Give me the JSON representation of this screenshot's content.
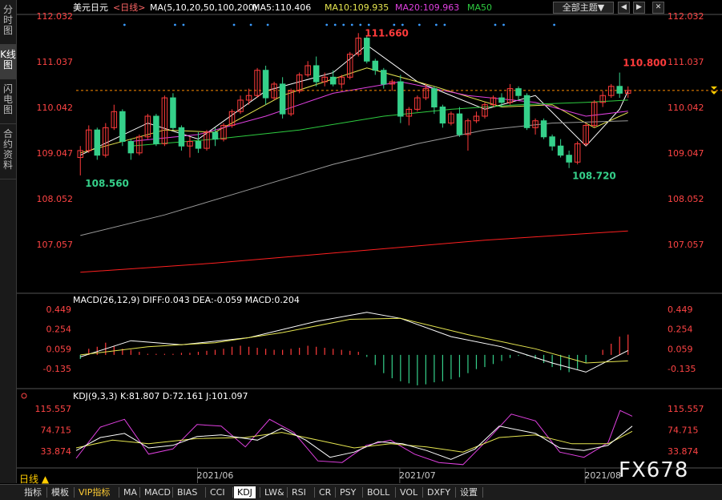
{
  "sidebar": [
    "分时图",
    "K线图",
    "闪电图",
    "合约资料"
  ],
  "header": {
    "symbol": "美元日元",
    "period_tag": "<日线>",
    "ma_label": "MA(5,10,20,50,100,200)",
    "ma5": "MA5:110.406",
    "ma10": "MA10:109.935",
    "ma20": "MA20:109.963",
    "ma50": "MA50",
    "theme_button": "全部主题▼"
  },
  "colors": {
    "up": "#ff3b3b",
    "down": "#35d08a",
    "ma5": "#ffffff",
    "ma10": "#e6e650",
    "ma20": "#e040e0",
    "ma50": "#2ecc40",
    "ma100": "#9a9a9a",
    "ma200": "#ff2020",
    "axis_text": "#ff4444",
    "price_line": "#ff8c00"
  },
  "chart_data": [
    {
      "type": "candlestick",
      "title": "美元日元 <日线>",
      "y_ticks": [
        112.032,
        111.037,
        110.042,
        109.047,
        108.052,
        107.057
      ],
      "ylim": [
        106.3,
        112.3
      ],
      "x_ticks": [
        "2021/06",
        "2021/07",
        "2021/08"
      ],
      "annotations": [
        "108.560",
        "111.660",
        "110.800",
        "108.720"
      ],
      "current_price": 110.41,
      "note": "candle OHLC not printed; candles below are an approximate price path",
      "candles": [
        [
          108.95,
          109.2,
          108.56,
          109.1
        ],
        [
          109.1,
          109.65,
          109.05,
          109.55
        ],
        [
          109.55,
          109.6,
          108.9,
          109.0
        ],
        [
          109.0,
          109.7,
          108.95,
          109.6
        ],
        [
          109.6,
          110.1,
          109.55,
          109.95
        ],
        [
          109.95,
          110.0,
          109.2,
          109.3
        ],
        [
          109.3,
          109.35,
          108.9,
          109.05
        ],
        [
          109.05,
          109.45,
          109.0,
          109.4
        ],
        [
          109.4,
          109.9,
          109.35,
          109.85
        ],
        [
          109.85,
          109.9,
          109.2,
          109.25
        ],
        [
          109.25,
          110.3,
          109.2,
          110.25
        ],
        [
          110.25,
          110.35,
          109.55,
          109.6
        ],
        [
          109.6,
          109.65,
          109.1,
          109.2
        ],
        [
          109.2,
          109.4,
          108.95,
          109.3
        ],
        [
          109.3,
          109.5,
          109.05,
          109.15
        ],
        [
          109.15,
          109.55,
          109.1,
          109.5
        ],
        [
          109.5,
          109.6,
          109.2,
          109.35
        ],
        [
          109.35,
          109.7,
          109.3,
          109.65
        ],
        [
          109.65,
          110.0,
          109.6,
          109.95
        ],
        [
          109.95,
          110.3,
          109.9,
          110.2
        ],
        [
          110.2,
          110.45,
          110.1,
          110.3
        ],
        [
          110.3,
          110.9,
          110.25,
          110.85
        ],
        [
          110.85,
          110.95,
          110.1,
          110.25
        ],
        [
          110.25,
          110.6,
          110.2,
          110.55
        ],
        [
          110.55,
          110.7,
          109.8,
          109.9
        ],
        [
          109.9,
          110.45,
          109.85,
          110.4
        ],
        [
          110.4,
          110.8,
          110.35,
          110.75
        ],
        [
          110.75,
          111.05,
          110.7,
          110.95
        ],
        [
          110.95,
          111.15,
          110.5,
          110.6
        ],
        [
          110.6,
          110.8,
          110.5,
          110.7
        ],
        [
          110.7,
          110.85,
          110.5,
          110.55
        ],
        [
          110.55,
          110.75,
          110.45,
          110.7
        ],
        [
          110.7,
          111.25,
          110.65,
          111.2
        ],
        [
          111.2,
          111.66,
          111.15,
          111.55
        ],
        [
          111.55,
          111.6,
          111.0,
          111.05
        ],
        [
          111.05,
          111.1,
          110.75,
          110.85
        ],
        [
          110.85,
          110.9,
          110.45,
          110.55
        ],
        [
          110.55,
          110.65,
          110.4,
          110.6
        ],
        [
          110.6,
          110.75,
          109.7,
          109.85
        ],
        [
          109.85,
          110.05,
          109.65,
          110.0
        ],
        [
          110.0,
          110.3,
          109.95,
          110.25
        ],
        [
          110.25,
          110.55,
          110.2,
          110.45
        ],
        [
          110.45,
          110.5,
          109.9,
          110.05
        ],
        [
          110.05,
          110.1,
          109.6,
          109.7
        ],
        [
          109.7,
          109.95,
          109.65,
          109.9
        ],
        [
          109.9,
          110.05,
          109.4,
          109.45
        ],
        [
          109.45,
          109.8,
          109.1,
          109.75
        ],
        [
          109.75,
          109.95,
          109.7,
          109.85
        ],
        [
          109.85,
          110.15,
          109.8,
          110.1
        ],
        [
          110.1,
          110.3,
          110.05,
          110.25
        ],
        [
          110.25,
          110.35,
          110.05,
          110.15
        ],
        [
          110.15,
          110.55,
          110.1,
          110.45
        ],
        [
          110.45,
          110.5,
          110.2,
          110.3
        ],
        [
          110.3,
          110.35,
          109.55,
          109.6
        ],
        [
          109.6,
          109.8,
          109.45,
          109.75
        ],
        [
          109.75,
          109.8,
          109.35,
          109.4
        ],
        [
          109.4,
          109.45,
          109.1,
          109.2
        ],
        [
          109.2,
          109.35,
          108.95,
          109.0
        ],
        [
          109.0,
          109.1,
          108.72,
          108.85
        ],
        [
          108.85,
          109.3,
          108.8,
          109.25
        ],
        [
          109.25,
          109.7,
          109.2,
          109.65
        ],
        [
          109.65,
          110.2,
          109.6,
          110.15
        ],
        [
          110.15,
          110.4,
          110.05,
          110.3
        ],
        [
          110.3,
          110.55,
          110.25,
          110.5
        ],
        [
          110.5,
          110.8,
          110.25,
          110.35
        ],
        [
          110.35,
          110.5,
          110.25,
          110.41
        ]
      ],
      "ma_lines": {
        "ma5": [
          [
            0,
            109.0
          ],
          [
            8,
            109.7
          ],
          [
            14,
            109.35
          ],
          [
            22,
            110.4
          ],
          [
            30,
            110.8
          ],
          [
            34,
            111.4
          ],
          [
            40,
            110.6
          ],
          [
            48,
            110.0
          ],
          [
            54,
            110.3
          ],
          [
            60,
            109.2
          ],
          [
            64,
            110.0
          ],
          [
            65,
            110.4
          ]
        ],
        "ma10": [
          [
            0,
            109.05
          ],
          [
            10,
            109.55
          ],
          [
            16,
            109.5
          ],
          [
            24,
            110.3
          ],
          [
            34,
            110.9
          ],
          [
            42,
            110.5
          ],
          [
            50,
            110.05
          ],
          [
            56,
            110.1
          ],
          [
            61,
            109.6
          ],
          [
            65,
            109.93
          ]
        ],
        "ma20": [
          [
            6,
            109.3
          ],
          [
            14,
            109.45
          ],
          [
            22,
            109.85
          ],
          [
            30,
            110.35
          ],
          [
            38,
            110.6
          ],
          [
            46,
            110.3
          ],
          [
            54,
            110.15
          ],
          [
            60,
            109.85
          ],
          [
            65,
            109.96
          ]
        ],
        "ma50": [
          [
            6,
            109.2
          ],
          [
            16,
            109.35
          ],
          [
            26,
            109.55
          ],
          [
            36,
            109.85
          ],
          [
            44,
            110.0
          ],
          [
            52,
            110.1
          ],
          [
            60,
            110.15
          ],
          [
            65,
            110.2
          ]
        ],
        "ma100": [
          [
            0,
            107.25
          ],
          [
            10,
            107.7
          ],
          [
            20,
            108.25
          ],
          [
            30,
            108.8
          ],
          [
            40,
            109.25
          ],
          [
            48,
            109.55
          ],
          [
            56,
            109.7
          ],
          [
            65,
            109.75
          ]
        ],
        "ma200": [
          [
            0,
            106.45
          ],
          [
            16,
            106.65
          ],
          [
            32,
            106.9
          ],
          [
            48,
            107.15
          ],
          [
            65,
            107.35
          ]
        ]
      }
    },
    {
      "type": "line",
      "title": "MACD(26,12,9) DIFF:0.043 DEA:-0.059 MACD:0.204",
      "y_ticks": [
        0.449,
        0.254,
        0.059,
        -0.135
      ],
      "ylim": [
        -0.34,
        0.52
      ],
      "diff": [
        [
          0,
          -0.02
        ],
        [
          6,
          0.14
        ],
        [
          12,
          0.1
        ],
        [
          20,
          0.17
        ],
        [
          28,
          0.33
        ],
        [
          34,
          0.42
        ],
        [
          38,
          0.36
        ],
        [
          44,
          0.18
        ],
        [
          50,
          0.08
        ],
        [
          56,
          -0.08
        ],
        [
          60,
          -0.17
        ],
        [
          65,
          0.043
        ]
      ],
      "dea": [
        [
          0,
          0.0
        ],
        [
          8,
          0.08
        ],
        [
          16,
          0.12
        ],
        [
          24,
          0.22
        ],
        [
          32,
          0.35
        ],
        [
          38,
          0.36
        ],
        [
          46,
          0.2
        ],
        [
          54,
          0.06
        ],
        [
          60,
          -0.08
        ],
        [
          65,
          -0.059
        ]
      ],
      "histogram": [
        -0.04,
        0.06,
        0.08,
        0.12,
        0.09,
        0.06,
        0.05,
        0.03,
        0.01,
        0.01,
        0.01,
        0.01,
        0.02,
        0.02,
        0.03,
        0.04,
        0.05,
        0.06,
        0.08,
        0.09,
        0.08,
        0.07,
        0.06,
        0.05,
        0.05,
        0.06,
        0.07,
        0.09,
        0.08,
        0.07,
        0.06,
        0.05,
        0.04,
        0.03,
        -0.02,
        -0.1,
        -0.18,
        -0.23,
        -0.26,
        -0.28,
        -0.3,
        -0.29,
        -0.27,
        -0.26,
        -0.24,
        -0.22,
        -0.18,
        -0.14,
        -0.12,
        -0.09,
        -0.06,
        -0.03,
        -0.01,
        -0.01,
        -0.04,
        -0.08,
        -0.12,
        -0.15,
        -0.17,
        -0.14,
        -0.08,
        0.0,
        0.05,
        0.11,
        0.18,
        0.2
      ]
    },
    {
      "type": "line",
      "title": "KDJ(9,3,3) K:81.807 D:72.161 J:101.097",
      "y_ticks": [
        115.557,
        74.715,
        33.874
      ],
      "ylim": [
        0,
        128
      ],
      "k": [
        [
          0,
          35
        ],
        [
          4,
          60
        ],
        [
          8,
          68
        ],
        [
          12,
          40
        ],
        [
          16,
          45
        ],
        [
          20,
          62
        ],
        [
          24,
          65
        ],
        [
          30,
          55
        ],
        [
          34,
          78
        ],
        [
          38,
          55
        ],
        [
          42,
          22
        ],
        [
          46,
          32
        ],
        [
          50,
          52
        ],
        [
          54,
          48
        ],
        [
          58,
          35
        ],
        [
          62,
          18
        ],
        [
          66,
          38
        ],
        [
          70,
          82
        ],
        [
          76,
          68
        ],
        [
          80,
          40
        ],
        [
          84,
          35
        ],
        [
          88,
          45
        ],
        [
          92,
          82
        ]
      ],
      "d": [
        [
          0,
          40
        ],
        [
          6,
          55
        ],
        [
          12,
          48
        ],
        [
          20,
          58
        ],
        [
          28,
          60
        ],
        [
          34,
          70
        ],
        [
          40,
          55
        ],
        [
          46,
          40
        ],
        [
          52,
          48
        ],
        [
          58,
          42
        ],
        [
          64,
          32
        ],
        [
          70,
          60
        ],
        [
          76,
          65
        ],
        [
          82,
          48
        ],
        [
          88,
          48
        ],
        [
          92,
          72
        ]
      ],
      "j": [
        [
          0,
          20
        ],
        [
          4,
          80
        ],
        [
          8,
          95
        ],
        [
          12,
          28
        ],
        [
          16,
          38
        ],
        [
          20,
          85
        ],
        [
          24,
          82
        ],
        [
          28,
          42
        ],
        [
          32,
          95
        ],
        [
          36,
          70
        ],
        [
          40,
          15
        ],
        [
          44,
          12
        ],
        [
          48,
          45
        ],
        [
          52,
          55
        ],
        [
          56,
          28
        ],
        [
          60,
          12
        ],
        [
          64,
          8
        ],
        [
          68,
          55
        ],
        [
          72,
          105
        ],
        [
          76,
          92
        ],
        [
          80,
          32
        ],
        [
          84,
          22
        ],
        [
          88,
          50
        ],
        [
          90,
          112
        ],
        [
          92,
          101
        ]
      ],
      "x_span": 92
    }
  ],
  "bottom_tabs": [
    "指标",
    "模板",
    "VIP指标",
    "MA",
    "MACD",
    "BIAS",
    "CCI",
    "KDJ",
    "LW&",
    "RSI",
    "CR",
    "PSY",
    "BOLL",
    "VOL",
    "DXFY",
    "设置"
  ],
  "period_label": "日线 ▲",
  "watermark": "FX678"
}
